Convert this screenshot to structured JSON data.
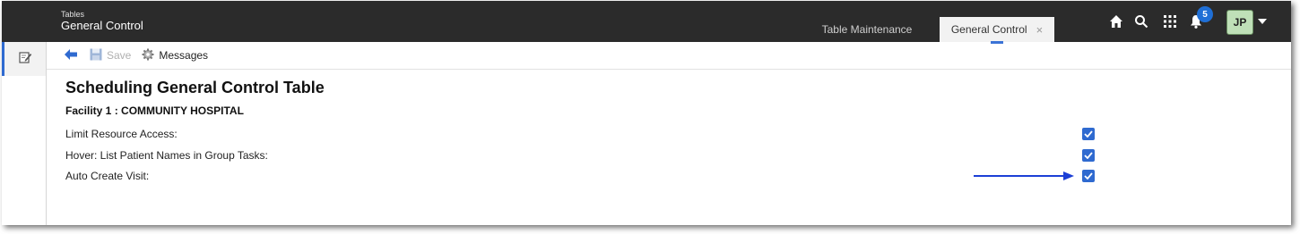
{
  "header": {
    "module": "Tables",
    "title": "General Control",
    "tabs": [
      {
        "label": "Table Maintenance",
        "active": false
      },
      {
        "label": "General Control",
        "active": true,
        "close": "×"
      }
    ],
    "icons": [
      "home-icon",
      "search-icon",
      "apps-grid-icon",
      "bell-icon"
    ],
    "notification_count": "5",
    "user_initials": "JP"
  },
  "toolbar": {
    "save_label": "Save",
    "messages_label": "Messages"
  },
  "page": {
    "title": "Scheduling General Control Table",
    "facility": "Facility 1 : COMMUNITY HOSPITAL",
    "settings": [
      {
        "label": "Limit Resource Access:",
        "checked": true
      },
      {
        "label": "Hover: List Patient Names in Group Tasks:",
        "checked": true
      },
      {
        "label": "Auto Create Visit:",
        "checked": true
      }
    ]
  },
  "colors": {
    "topbar": "#2b2b2b",
    "accent": "#2f6ad0",
    "badge": "#1f6fd6",
    "avatar_bg": "#bfe0b8",
    "annotation_arrow": "#1c3fd6"
  }
}
